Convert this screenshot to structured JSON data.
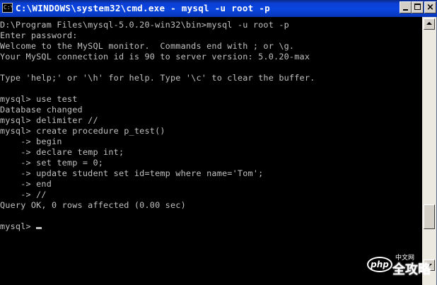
{
  "window": {
    "title": "C:\\WINDOWS\\system32\\cmd.exe - mysql -u root -p",
    "icon": "cmd-console-icon",
    "icon_glyph": "C:\\"
  },
  "titlebar_buttons": {
    "minimize": "minimize-icon",
    "maximize": "maximize-icon",
    "close_label": "×"
  },
  "console": {
    "lines": [
      "D:\\Program Files\\mysql-5.0.20-win32\\bin>mysql -u root -p",
      "Enter password:",
      "Welcome to the MySQL monitor.  Commands end with ; or \\g.",
      "Your MySQL connection id is 90 to server version: 5.0.20-max",
      "",
      "Type 'help;' or '\\h' for help. Type '\\c' to clear the buffer.",
      "",
      "mysql> use test",
      "Database changed",
      "mysql> delimiter //",
      "mysql> create procedure p_test()",
      "    -> begin",
      "    -> declare temp int;",
      "    -> set temp = 0;",
      "    -> update student set id=temp where name='Tom';",
      "    -> end",
      "    -> //",
      "Query OK, 0 rows affected (0.00 sec)",
      "",
      "mysql> "
    ]
  },
  "colors": {
    "console_background": "#000000",
    "console_text": "#c0c0c0",
    "titlebar": "#0a45e0"
  },
  "watermark": {
    "logo_text": "php",
    "small_text": "中文网",
    "big_text": "全攻略"
  }
}
